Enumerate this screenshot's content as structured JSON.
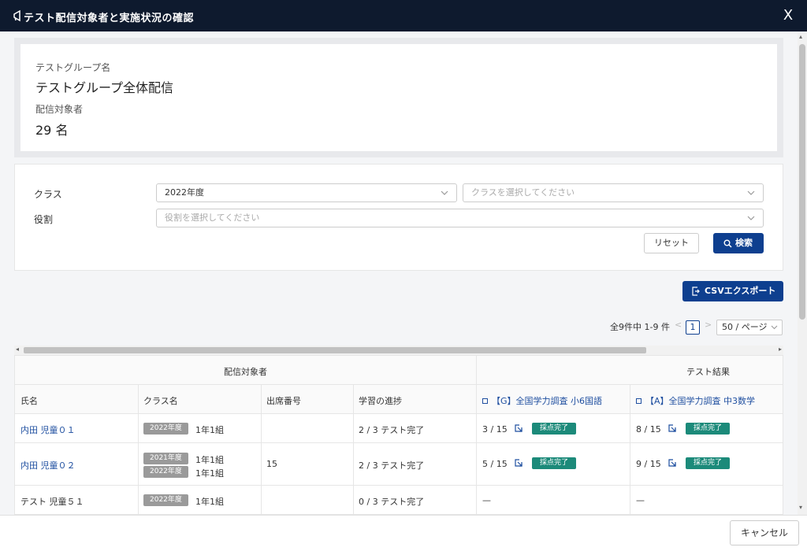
{
  "window": {
    "title": "テスト配信対象者と実施状況の確認",
    "close_label": "X"
  },
  "info": {
    "group_label": "テストグループ名",
    "group_value": "テストグループ全体配信",
    "target_label": "配信対象者",
    "target_value": "29 名"
  },
  "filters": {
    "class_label": "クラス",
    "year_value": "2022年度",
    "class_placeholder": "クラスを選択してください",
    "role_label": "役割",
    "role_placeholder": "役割を選択してください",
    "reset_label": "リセット",
    "search_label": "検索"
  },
  "toolbar": {
    "csv_label": "CSVエクスポート"
  },
  "pager": {
    "total_text": "全9件中 1-9 件",
    "prev": "<",
    "current_page": "1",
    "next": ">",
    "page_size": "50 / ページ"
  },
  "table": {
    "group_headers": {
      "targets": "配信対象者",
      "results": "テスト結果"
    },
    "columns": {
      "name": "氏名",
      "class": "クラス名",
      "number": "出席番号",
      "progress": "学習の進捗",
      "test1": "【G】全国学力調査 小6国語",
      "test2": "【A】全国学力調査 中3数学"
    },
    "rows": [
      {
        "name": "内田 児童０１",
        "classes": [
          {
            "year": "2022年度",
            "class": "1年1組"
          }
        ],
        "number": "",
        "progress": "2 / 3 テスト完了",
        "test1_score": "3 / 15",
        "test1_status": "採点完了",
        "test2_score": "8 / 15",
        "test2_status": "採点完了"
      },
      {
        "name": "内田 児童０２",
        "classes": [
          {
            "year": "2021年度",
            "class": "1年1組"
          },
          {
            "year": "2022年度",
            "class": "1年1組"
          }
        ],
        "number": "15",
        "progress": "2 / 3 テスト完了",
        "test1_score": "5 / 15",
        "test1_status": "採点完了",
        "test2_score": "9 / 15",
        "test2_status": "採点完了"
      },
      {
        "name": "テスト 児童５１",
        "classes": [
          {
            "year": "2022年度",
            "class": "1年1組"
          }
        ],
        "number": "",
        "progress": "0 / 3 テスト完了",
        "test1_score": "—",
        "test1_status": "",
        "test2_score": "—",
        "test2_status": ""
      }
    ]
  },
  "footer": {
    "cancel_label": "キャンセル"
  },
  "colors": {
    "titlebar": "#0e1a2e",
    "primary": "#0e3f8f",
    "status_badge": "#1c8a7a",
    "class_badge": "#9a9a9a",
    "link": "#1f4fa0"
  },
  "icons": {
    "title": "megaphone-icon",
    "close": "close-icon",
    "search": "search-icon",
    "export": "export-icon",
    "open_result": "external-link-icon"
  }
}
